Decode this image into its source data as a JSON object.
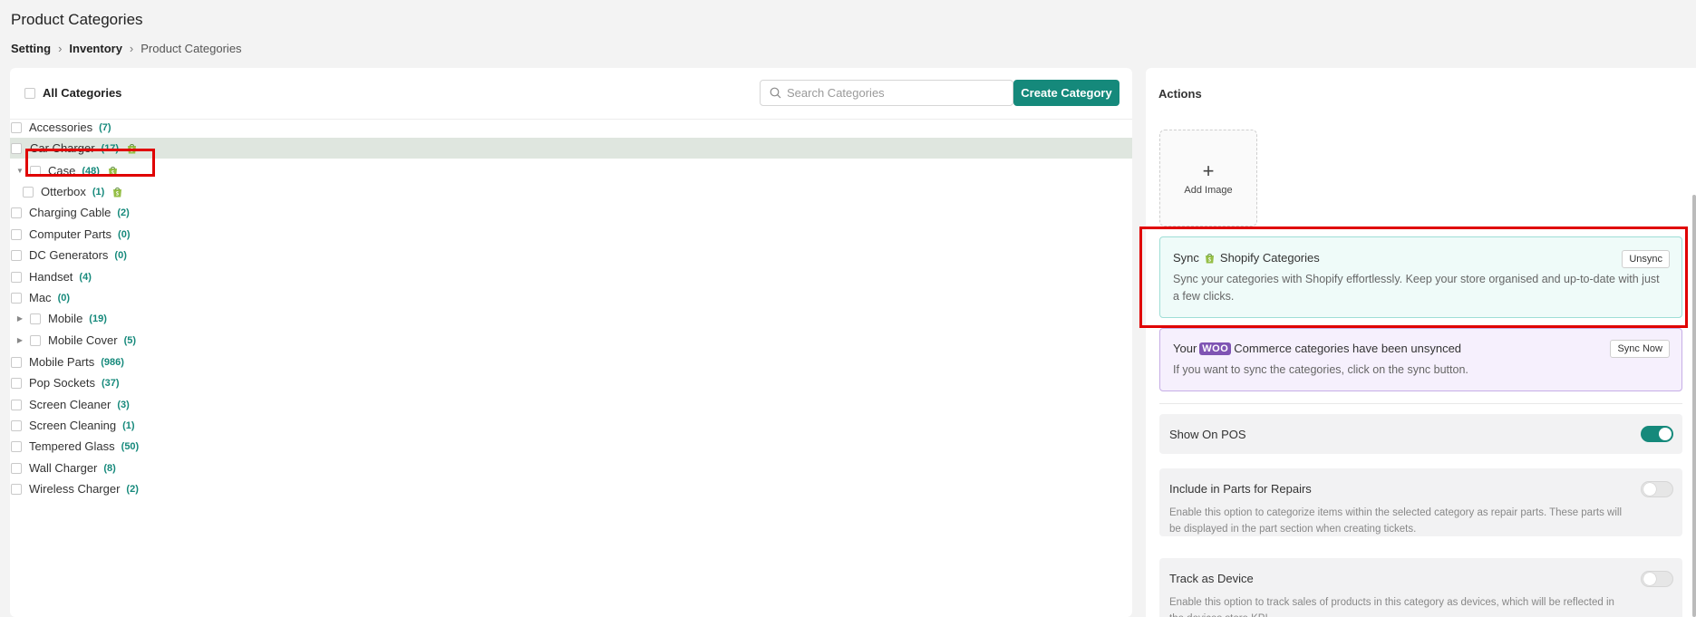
{
  "page": {
    "title": "Product Categories",
    "breadcrumb": [
      "Setting",
      "Inventory",
      "Product Categories"
    ]
  },
  "categories_panel": {
    "all_label": "All Categories",
    "search_placeholder": "Search Categories",
    "create_button": "Create Category",
    "items": [
      {
        "name": "Accessories",
        "count": "(7)",
        "shopify": false,
        "level": 0,
        "expandable": false,
        "selected": false
      },
      {
        "name": "Car Charger",
        "count": "(17)",
        "shopify": true,
        "level": 0,
        "expandable": false,
        "selected": true
      },
      {
        "name": "Case",
        "count": "(48)",
        "shopify": true,
        "level": 0,
        "expandable": true,
        "expanded": true,
        "selected": false
      },
      {
        "name": "Otterbox",
        "count": "(1)",
        "shopify": true,
        "level": 1,
        "expandable": false,
        "selected": false
      },
      {
        "name": "Charging Cable",
        "count": "(2)",
        "shopify": false,
        "level": 0,
        "expandable": false,
        "selected": false
      },
      {
        "name": "Computer Parts",
        "count": "(0)",
        "shopify": false,
        "level": 0,
        "expandable": false,
        "selected": false
      },
      {
        "name": "DC Generators",
        "count": "(0)",
        "shopify": false,
        "level": 0,
        "expandable": false,
        "selected": false
      },
      {
        "name": "Handset",
        "count": "(4)",
        "shopify": false,
        "level": 0,
        "expandable": false,
        "selected": false
      },
      {
        "name": "Mac",
        "count": "(0)",
        "shopify": false,
        "level": 0,
        "expandable": false,
        "selected": false
      },
      {
        "name": "Mobile",
        "count": "(19)",
        "shopify": false,
        "level": 0,
        "expandable": true,
        "expanded": false,
        "selected": false
      },
      {
        "name": "Mobile Cover",
        "count": "(5)",
        "shopify": false,
        "level": 0,
        "expandable": true,
        "expanded": false,
        "selected": false
      },
      {
        "name": "Mobile Parts",
        "count": "(986)",
        "shopify": false,
        "level": 0,
        "expandable": false,
        "selected": false
      },
      {
        "name": "Pop Sockets",
        "count": "(37)",
        "shopify": false,
        "level": 0,
        "expandable": false,
        "selected": false
      },
      {
        "name": "Screen Cleaner",
        "count": "(3)",
        "shopify": false,
        "level": 0,
        "expandable": false,
        "selected": false
      },
      {
        "name": "Screen Cleaning",
        "count": "(1)",
        "shopify": false,
        "level": 0,
        "expandable": false,
        "selected": false
      },
      {
        "name": "Tempered Glass",
        "count": "(50)",
        "shopify": false,
        "level": 0,
        "expandable": false,
        "selected": false
      },
      {
        "name": "Wall Charger",
        "count": "(8)",
        "shopify": false,
        "level": 0,
        "expandable": false,
        "selected": false
      },
      {
        "name": "Wireless Charger",
        "count": "(2)",
        "shopify": false,
        "level": 0,
        "expandable": false,
        "selected": false
      }
    ]
  },
  "actions_panel": {
    "title": "Actions",
    "add_image_label": "Add Image",
    "shopify_sync": {
      "title_prefix": "Sync",
      "title_suffix": "Shopify Categories",
      "description": "Sync your categories with Shopify effortlessly. Keep your store organised and up-to-date with just a few clicks.",
      "button": "Unsync"
    },
    "woo_sync": {
      "title_prefix": "Your",
      "logo_text": "WOO",
      "title_suffix": "Commerce categories have been unsynced",
      "description": "If you want to sync the categories, click on the sync button.",
      "button": "Sync Now"
    },
    "toggles": [
      {
        "title": "Show On POS",
        "description": "",
        "on": true
      },
      {
        "title": "Include in Parts for Repairs",
        "description": "Enable this option to categorize items within the selected category as repair parts. These parts will be displayed in the part section when creating tickets.",
        "on": false
      },
      {
        "title": "Track as Device",
        "description": "Enable this option to track sales of products in this category as devices, which will be reflected in the devices store KPI.",
        "on": false
      }
    ]
  },
  "colors": {
    "accent": "#15897b",
    "shopify_green": "#95bf47",
    "woo_purple": "#7f54b3",
    "highlight_red": "#e00000"
  }
}
